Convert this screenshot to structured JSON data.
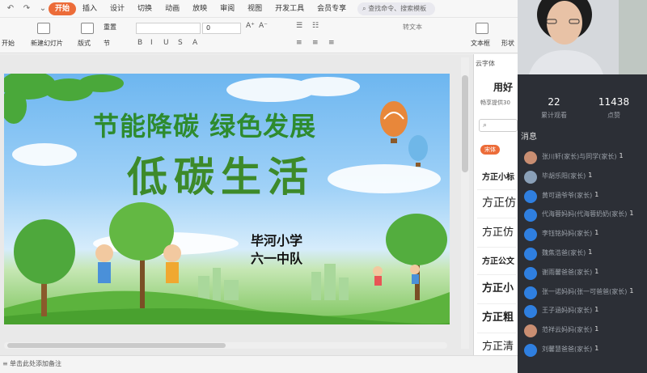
{
  "tabs": [
    "开始",
    "插入",
    "设计",
    "切换",
    "动画",
    "放映",
    "审阅",
    "视图",
    "开发工具",
    "会员专享"
  ],
  "search_placeholder": "查找命令、搜索模板",
  "ribbon": {
    "start_btn": "开始",
    "new_slide": "新建幻灯片",
    "layout": "版式",
    "section": "节",
    "reset": "重置",
    "font_size": "0",
    "text_box": "文本框",
    "shape": "形状",
    "convert_text": "转文本"
  },
  "slide": {
    "title1": "节能降碳 绿色发展",
    "title2": "低碳生活",
    "school": "毕河小学",
    "team": "六一中队"
  },
  "notes_label": "单击此处添加备注",
  "font_panel": {
    "header": "云字体",
    "title": "用好",
    "subtitle": "畅享提供30",
    "search_icon": "search-icon",
    "tag": "宋体",
    "items": [
      "方正小标",
      "方正仿",
      "方正仿",
      "方正公文",
      "方正小",
      "方正粗",
      "方正清"
    ]
  },
  "stats": {
    "watch_count": "22",
    "watch_label": "累计观看",
    "like_count": "11438",
    "like_label": "点赞"
  },
  "messages_header": "消息",
  "messages": [
    {
      "text": "张川轩(家长)与同学(家长)",
      "num": "1",
      "color": "#c98e72"
    },
    {
      "text": "毕胡乐阳(家长)",
      "num": "1",
      "color": "#8aa0b8"
    },
    {
      "text": "黄可涵爷爷(家长)",
      "num": "1",
      "color": "#2f7fe0"
    },
    {
      "text": "代海蓉妈妈(代海蓉奶奶(家长)",
      "num": "1",
      "color": "#2f7fe0"
    },
    {
      "text": "李钰铭妈妈(家长)",
      "num": "1",
      "color": "#2f7fe0"
    },
    {
      "text": "魏焦浩爸(家长)",
      "num": "1",
      "color": "#2f7fe0"
    },
    {
      "text": "谢雨馨爸爸(家长)",
      "num": "1",
      "color": "#2f7fe0"
    },
    {
      "text": "张一诺妈妈(张一可爸爸(家长)",
      "num": "1",
      "color": "#2f7fe0"
    },
    {
      "text": "王子涵妈妈(家长)",
      "num": "1",
      "color": "#2f7fe0"
    },
    {
      "text": "范祥云妈妈(家长)",
      "num": "1",
      "color": "#c98e72"
    },
    {
      "text": "刘馨慧爸爸(家长)",
      "num": "1",
      "color": "#2f7fe0"
    }
  ]
}
